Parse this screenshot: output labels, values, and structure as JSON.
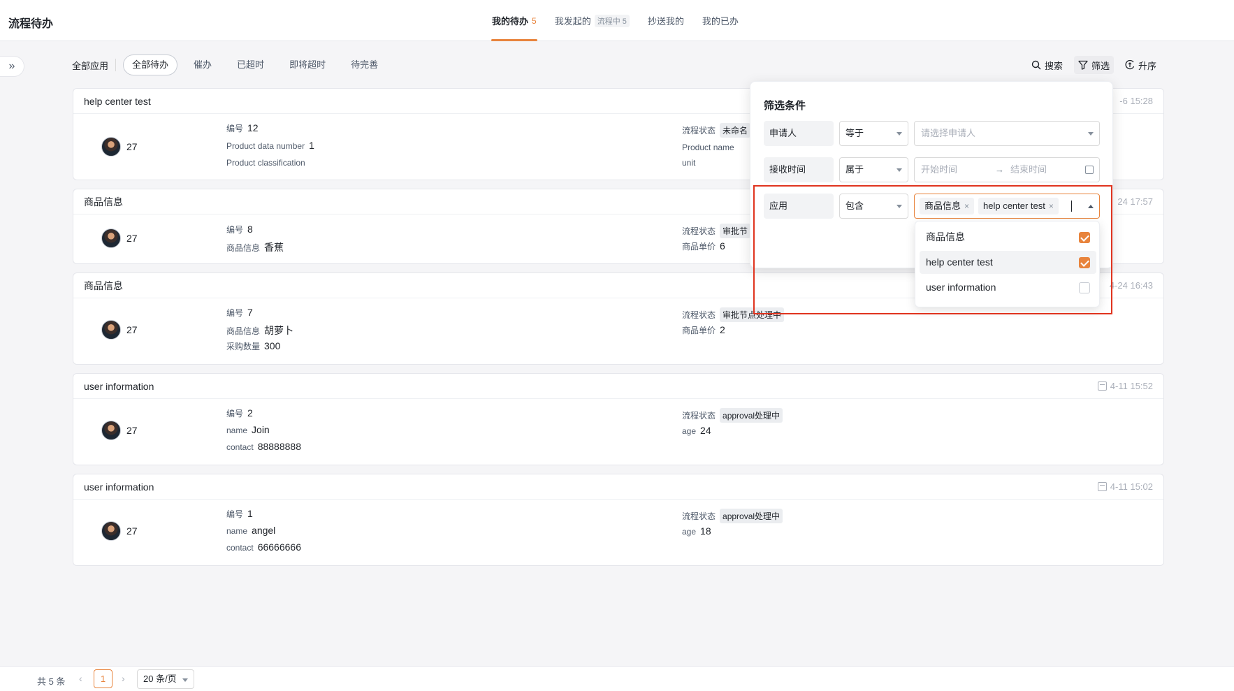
{
  "header": {
    "title": "流程待办",
    "tabs": [
      {
        "label": "我的待办",
        "count": "5"
      },
      {
        "label": "我发起的",
        "pill": "流程中 5"
      },
      {
        "label": "抄送我的"
      },
      {
        "label": "我的已办"
      }
    ]
  },
  "filters": {
    "all_apps": "全部应用",
    "chips": [
      "全部待办",
      "催办",
      "已超时",
      "即将超时",
      "待完善"
    ],
    "active_chip": "全部待办"
  },
  "tools": {
    "search": "搜索",
    "filter": "筛选",
    "sort": "升序"
  },
  "cards": [
    {
      "title": "help center test",
      "time": "-6 15:28",
      "user_num": "27",
      "left": [
        {
          "label": "编号",
          "value": "12"
        },
        {
          "label": "Product data number",
          "value": "1"
        },
        {
          "label": "Product classification",
          "value": ""
        }
      ],
      "right": [
        {
          "label": "流程状态",
          "tag": "未命名"
        },
        {
          "label": "Product name",
          "value": ""
        },
        {
          "label": "unit",
          "value": ""
        }
      ]
    },
    {
      "title": "商品信息",
      "time": "24 17:57",
      "user_num": "27",
      "left": [
        {
          "label": "编号",
          "value": "8"
        },
        {
          "label": "商品信息",
          "value": "香蕉"
        }
      ],
      "right": [
        {
          "label": "流程状态",
          "tag": "审批节"
        },
        {
          "label": "商品单价",
          "value": "6"
        }
      ]
    },
    {
      "title": "商品信息",
      "time": "4-24 16:43",
      "user_num": "27",
      "left": [
        {
          "label": "编号",
          "value": "7"
        },
        {
          "label": "商品信息",
          "value": "胡萝卜"
        },
        {
          "label": "采购数量",
          "value": "300"
        }
      ],
      "right": [
        {
          "label": "流程状态",
          "tag": "审批节点处理中"
        },
        {
          "label": "商品单价",
          "value": "2"
        }
      ]
    },
    {
      "title": "user information",
      "time": "4-11 15:52",
      "user_num": "27",
      "left": [
        {
          "label": "编号",
          "value": "2"
        },
        {
          "label": "name",
          "value": "Join"
        },
        {
          "label": "contact",
          "value": "88888888"
        }
      ],
      "right": [
        {
          "label": "流程状态",
          "tag": "approval处理中"
        },
        {
          "label": "age",
          "value": "24"
        }
      ]
    },
    {
      "title": "user information",
      "time": "4-11 15:02",
      "user_num": "27",
      "left": [
        {
          "label": "编号",
          "value": "1"
        },
        {
          "label": "name",
          "value": "angel"
        },
        {
          "label": "contact",
          "value": "66666666"
        }
      ],
      "right": [
        {
          "label": "流程状态",
          "tag": "approval处理中"
        },
        {
          "label": "age",
          "value": "18"
        }
      ]
    }
  ],
  "popover": {
    "title": "筛选条件",
    "conditions": [
      {
        "label": "申请人",
        "op": "等于",
        "placeholder": "请选择申请人"
      },
      {
        "label": "接收时间",
        "op": "属于",
        "start_placeholder": "开始时间",
        "end_placeholder": "结束时间",
        "arrow": "→"
      },
      {
        "label": "应用",
        "op": "包含",
        "selected": [
          "商品信息",
          "help center test"
        ]
      }
    ],
    "options": [
      {
        "label": "商品信息",
        "checked": true
      },
      {
        "label": "help center test",
        "checked": true
      },
      {
        "label": "user information",
        "checked": false
      }
    ]
  },
  "pager": {
    "total": "共 5 条",
    "page": "1",
    "size": "20 条/页",
    "prev": "‹",
    "next": "›"
  },
  "colors": {
    "accent": "#e8843d",
    "highlight": "#e0341f"
  }
}
